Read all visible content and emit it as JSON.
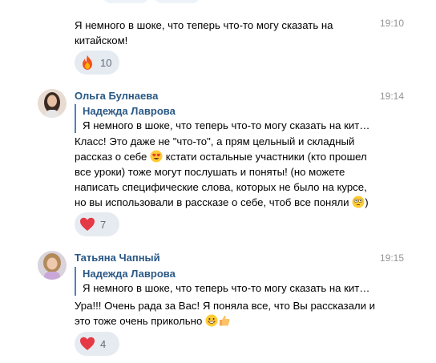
{
  "messages": [
    {
      "time": "19:10",
      "text_lines": [
        "Я немного в шоке, что теперь что-то могу сказать на",
        "китайском!"
      ],
      "reaction": {
        "icon": "fire-icon",
        "count": "10"
      }
    },
    {
      "author": "Ольга Булнаева",
      "time": "19:14",
      "quote": {
        "author": "Надежда Лаврова",
        "text": "Я немного в шоке, что теперь что-то могу сказать на кит…"
      },
      "text_lines": [
        "Класс! Это даже не \"что-то\", а прям цельный и складный",
        "рассказ о себе",
        "кстати остальные участники (кто прошел",
        "все уроки) тоже могут послушать и поняты! (но можете",
        "написать специфические слова, которых не было на курсе,",
        "но вы использовали в рассказе о себе, чтоб все поняли",
        ")"
      ],
      "reaction": {
        "icon": "heart-icon",
        "count": "7"
      }
    },
    {
      "author": "Татьяна Чапный",
      "time": "19:15",
      "quote": {
        "author": "Надежда Лаврова",
        "text": "Я немного в шоке, что теперь что-то могу сказать на кит…"
      },
      "text_lines": [
        "Ура!!! Очень рада за Вас! Я поняла все, что Вы рассказали и",
        "это тоже очень прикольно"
      ],
      "reaction": {
        "icon": "heart-icon",
        "count": "4"
      }
    }
  ],
  "colors": {
    "author": "#2a5885",
    "time": "#939393",
    "reaction_bg": "#e5ebf1",
    "quote_border": "#5181b8"
  }
}
